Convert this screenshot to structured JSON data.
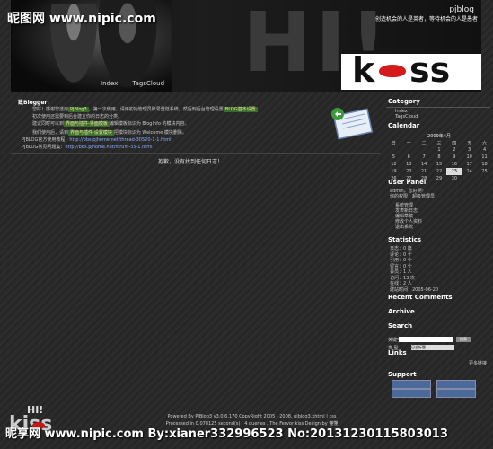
{
  "watermark": {
    "top": "昵图网 www.nipic.com",
    "bottom": "昵享网 www.nipic.com By:xianer332996523 No:20131230115803013"
  },
  "header": {
    "blog_name": "pjblog",
    "slogan": "创造机会的人是英者，等待机会的人是愚者",
    "hi_text": "HI!",
    "logo_left": "k",
    "logo_right": "ss",
    "nav": [
      "Index",
      "TagsCloud"
    ]
  },
  "main": {
    "hello": "致Blogger:",
    "paragraph1_a": "您好！感谢您选用",
    "paragraph1_hl1": "PJBlog3",
    "paragraph1_b": "，第一次使用，请用初始管理员账号登陆系统，然后到后台管理设置",
    "paragraph1_hl2": "BLOG基本设置",
    "paragraph2": "初次使用还需要到后台建立你的日志的分类。",
    "paragraph3_a": "建议同时可以到",
    "paragraph3_hl1": "界面与插件-界面模板",
    "paragraph3_b": "编辑模板标识为 BlogInfo 的模块内容。",
    "paragraph4_a": "我们使用后，请到",
    "paragraph4_hl1": "界面与插件-设置模块",
    "paragraph4_b": "把模块标识为 Welcome 模块删除。",
    "link1_label": "PJBLOG官方使用教程：",
    "link1": "http://bbs.pjhome.net/thread-30520-1-1.html",
    "link2_label": "PJBLOG常见问题集：",
    "link2": "http://bbs.pjhome.net/forum-35-1.html",
    "welcome_link": "抱歉，没有找到任何日志！"
  },
  "sidebar": {
    "category_title": "Category",
    "category_items": [
      "Index",
      "TagsCloud"
    ],
    "calendar_title": "Calendar",
    "calendar_month": "2009年4月",
    "weekdays": [
      "日",
      "一",
      "二",
      "三",
      "四",
      "五",
      "六"
    ],
    "weeks": [
      [
        "",
        "",
        "",
        "1",
        "2",
        "3",
        "4"
      ],
      [
        "5",
        "6",
        "7",
        "8",
        "9",
        "10",
        "11"
      ],
      [
        "12",
        "13",
        "14",
        "15",
        "16",
        "17",
        "18"
      ],
      [
        "19",
        "20",
        "21",
        "22",
        "23",
        "24",
        "25"
      ],
      [
        "26",
        "27",
        "28",
        "29",
        "30",
        "",
        ""
      ]
    ],
    "today": "23",
    "user_title": "User Panel",
    "user_greeting": "admin，您好啊！",
    "user_role": "你的权限：超级管理员",
    "user_menu": [
      "系统管理",
      "发表新日志",
      "编辑草稿",
      "修改个人资料",
      "退出系统"
    ],
    "stats_title": "Statistics",
    "stats": [
      "日志：0 篇",
      "评论：0 个",
      "引用：0 个",
      "留言：0 个",
      "会员：1 人",
      "访问：13 次",
      "在线：2 人",
      "建站时间：2005-06-20"
    ],
    "recent_comments_title": "Recent Comments",
    "archive_title": "Archive",
    "search_title": "Search",
    "search_label": "关键字",
    "search_placeholder": "",
    "search_button": "搜索",
    "search_select_label": "类 型",
    "search_select_value": "日志标题",
    "links_title": "Links",
    "links_more": "更多链接",
    "support_title": "Support"
  },
  "footer": {
    "line1": "Powered By PJBlog3 v3.0.6.170 CopyRight 2005 - 2008, pjblog3.xhtml | css",
    "line2": "Processed in 0.078125 second(s) , 4 queries , The Fervor kiss Design by 懂懂",
    "hi_text": "HI!",
    "kiss_text": "kiss"
  }
}
